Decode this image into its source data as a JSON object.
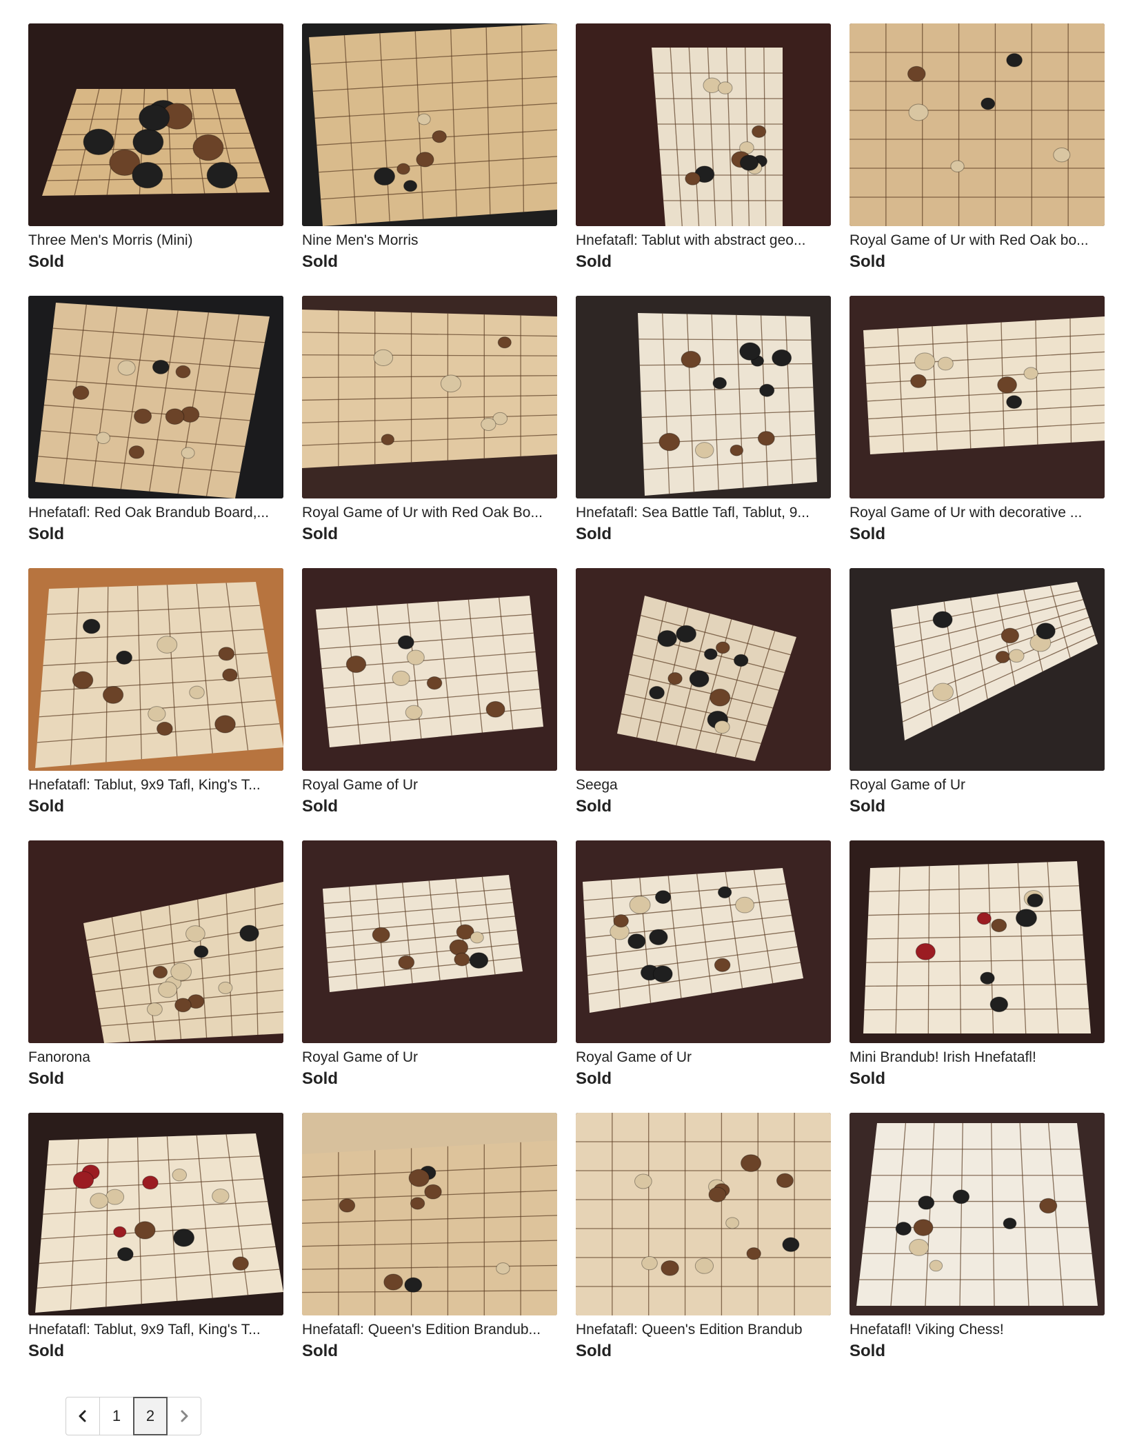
{
  "listings": [
    {
      "title": "Three Men's Morris (Mini)",
      "status": "Sold",
      "image": "three-mens-morris-board-photo",
      "board_color": "#d8b785",
      "bg_color": "#2a1a18"
    },
    {
      "title": "Nine Men's Morris",
      "status": "Sold",
      "image": "nine-mens-morris-board-photo",
      "board_color": "#d9bb8c",
      "bg_color": "#1e1e1e"
    },
    {
      "title": "Hnefatafl: Tablut with abstract geo...",
      "status": "Sold",
      "image": "tablut-board-photo",
      "board_color": "#eadfcb",
      "bg_color": "#3b1f1c"
    },
    {
      "title": "Royal Game of Ur with Red Oak bo...",
      "status": "Sold",
      "image": "royal-game-of-ur-board-photo",
      "board_color": "#d7b98e",
      "bg_color": "#3a2620"
    },
    {
      "title": "Hnefatafl: Red Oak Brandub Board,...",
      "status": "Sold",
      "image": "brandub-board-photo",
      "board_color": "#dcc199",
      "bg_color": "#1b1b1d"
    },
    {
      "title": "Royal Game of Ur with Red Oak Bo...",
      "status": "Sold",
      "image": "royal-game-of-ur-board-photo",
      "board_color": "#e2c9a2",
      "bg_color": "#3b2723"
    },
    {
      "title": "Hnefatafl: Sea Battle Tafl, Tablut, 9...",
      "status": "Sold",
      "image": "sea-battle-tafl-board-photo",
      "board_color": "#ede4d3",
      "bg_color": "#2e2624"
    },
    {
      "title": "Royal Game of Ur with decorative ...",
      "status": "Sold",
      "image": "royal-game-of-ur-board-photo",
      "board_color": "#eee2cc",
      "bg_color": "#3a2422"
    },
    {
      "title": "Hnefatafl: Tablut, 9x9 Tafl, King's T...",
      "status": "Sold",
      "image": "tablut-board-photo",
      "board_color": "#e9d8bb",
      "bg_color": "#b7743f"
    },
    {
      "title": "Royal Game of Ur",
      "status": "Sold",
      "image": "royal-game-of-ur-board-photo",
      "board_color": "#eee3d0",
      "bg_color": "#3a2221"
    },
    {
      "title": "Seega",
      "status": "Sold",
      "image": "seega-board-photo",
      "board_color": "#e3d4bb",
      "bg_color": "#3c2321"
    },
    {
      "title": "Royal Game of Ur",
      "status": "Sold",
      "image": "royal-game-of-ur-board-photo",
      "board_color": "#efe6d6",
      "bg_color": "#2b2423"
    },
    {
      "title": "Fanorona",
      "status": "Sold",
      "image": "fanorona-board-photo",
      "board_color": "#e7d6b8",
      "bg_color": "#3a201e"
    },
    {
      "title": "Royal Game of Ur",
      "status": "Sold",
      "image": "royal-game-of-ur-board-photo",
      "board_color": "#eee4d2",
      "bg_color": "#3b2322"
    },
    {
      "title": "Royal Game of Ur",
      "status": "Sold",
      "image": "royal-game-of-ur-board-photo",
      "board_color": "#eee4d2",
      "bg_color": "#3b2322"
    },
    {
      "title": "Mini Brandub! Irish Hnefatafl!",
      "status": "Sold",
      "image": "mini-brandub-board-photo",
      "board_color": "#f0e6d4",
      "bg_color": "#2f1d1b"
    },
    {
      "title": "Hnefatafl: Tablut, 9x9 Tafl, King's T...",
      "status": "Sold",
      "image": "tablut-board-photo",
      "board_color": "#efe3cd",
      "bg_color": "#2a1c1a"
    },
    {
      "title": "Hnefatafl: Queen's Edition Brandub...",
      "status": "Sold",
      "image": "queens-edition-brandub-photo",
      "board_color": "#ddc39b",
      "bg_color": "#d7c09c"
    },
    {
      "title": "Hnefatafl: Queen's Edition Brandub",
      "status": "Sold",
      "image": "queens-edition-brandub-photo",
      "board_color": "#e6d3b5",
      "bg_color": "#3b2a22"
    },
    {
      "title": "Hnefatafl! Viking Chess!",
      "status": "Sold",
      "image": "viking-chess-board-photo",
      "board_color": "#f1ebe0",
      "bg_color": "#3a2826"
    }
  ],
  "pagination": {
    "prev_icon": "chevron-left-icon",
    "next_icon": "chevron-right-icon",
    "pages": [
      "1",
      "2"
    ],
    "current_page": "2"
  },
  "colors": {
    "piece_dark": "#1f1f1f",
    "piece_red": "#9b1c22",
    "piece_wood": "#6b4328",
    "piece_light": "#d9c6a2",
    "burn_line": "#5a3b22"
  }
}
